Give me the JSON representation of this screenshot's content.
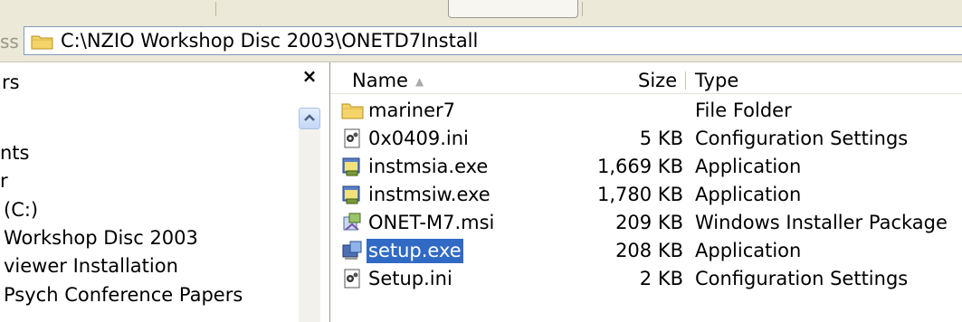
{
  "address": {
    "label": "ss",
    "path": "C:\\NZIO Workshop Disc 2003\\ONETD7Install"
  },
  "folders_pane": {
    "title": "rs",
    "close_glyph": "×",
    "items": [
      {
        "label": "nts"
      },
      {
        "label": "r"
      },
      {
        "label": "(C:)"
      },
      {
        "label": "Workshop Disc 2003"
      },
      {
        "label": "viewer Installation"
      },
      {
        "label": "Psych Conference Papers"
      }
    ]
  },
  "file_list": {
    "columns": {
      "name": "Name",
      "size": "Size",
      "type": "Type"
    },
    "sort_glyph": "▲",
    "rows": [
      {
        "icon": "folder-icon",
        "name": "mariner7",
        "size": "",
        "type": "File Folder"
      },
      {
        "icon": "config-file-icon",
        "name": "0x0409.ini",
        "size": "5 KB",
        "type": "Configuration Settings"
      },
      {
        "icon": "application-icon",
        "name": "instmsia.exe",
        "size": "1,669 KB",
        "type": "Application"
      },
      {
        "icon": "application-icon",
        "name": "instmsiw.exe",
        "size": "1,780 KB",
        "type": "Application"
      },
      {
        "icon": "installer-package-icon",
        "name": "ONET-M7.msi",
        "size": "209 KB",
        "type": "Windows Installer Package"
      },
      {
        "icon": "setup-icon",
        "name": "setup.exe",
        "size": "208 KB",
        "type": "Application",
        "selected": true
      },
      {
        "icon": "config-file-icon",
        "name": "Setup.ini",
        "size": "2 KB",
        "type": "Configuration Settings"
      }
    ]
  },
  "colors": {
    "chrome": "#ece9d8",
    "selection": "#316ac5",
    "folder": "#f3d36a"
  }
}
